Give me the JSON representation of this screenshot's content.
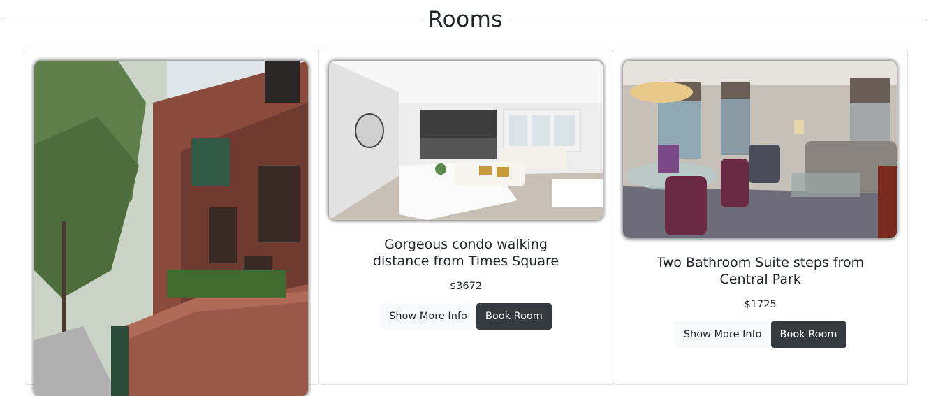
{
  "section": {
    "title": "Rooms"
  },
  "rooms": [
    {
      "title": "",
      "price": "",
      "more_label": "",
      "book_label": ""
    },
    {
      "title": "Gorgeous condo walking distance from Times Square",
      "price": "$3672",
      "more_label": "Show More Info",
      "book_label": "Book Room"
    },
    {
      "title": "Two Bathroom Suite steps from Central Park",
      "price": "$1725",
      "more_label": "Show More Info",
      "book_label": "Book Room"
    }
  ],
  "colors": {
    "dark_button": "#343a40",
    "light_button": "#f8f9fa",
    "card_border": "#e3e3e3"
  }
}
